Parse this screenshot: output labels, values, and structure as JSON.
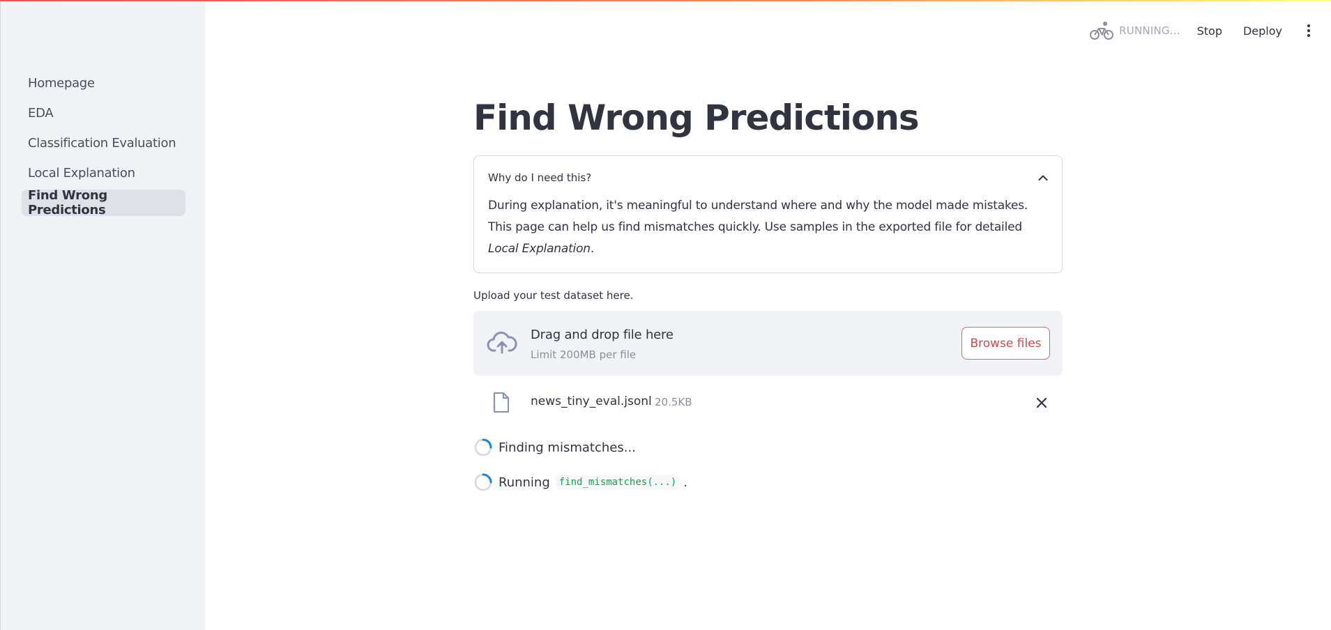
{
  "sidebar": {
    "items": [
      {
        "label": "Homepage",
        "active": false
      },
      {
        "label": "EDA",
        "active": false
      },
      {
        "label": "Classification Evaluation",
        "active": false
      },
      {
        "label": "Local Explanation",
        "active": false
      },
      {
        "label": "Find Wrong Predictions",
        "active": true
      }
    ]
  },
  "header": {
    "status_text": "RUNNING...",
    "stop_label": "Stop",
    "deploy_label": "Deploy",
    "running_icon": "bicycle-icon",
    "menu_icon": "kebab-menu-icon"
  },
  "main": {
    "title": "Find Wrong Predictions",
    "expander": {
      "title": "Why do I need this?",
      "body_text": "During explanation, it's meaningful to understand where and why the model made mistakes. This page can help us find mismatches quickly. Use samples in the exported file for detailed ",
      "body_emphasis": "Local Explanation",
      "body_end": "."
    },
    "upload": {
      "label": "Upload your test dataset here.",
      "drop_title": "Drag and drop file here",
      "drop_limit": "Limit 200MB per file",
      "browse_label": "Browse files"
    },
    "file": {
      "name": "news_tiny_eval.jsonl",
      "size": "20.5KB"
    },
    "status": {
      "finding": "Finding mismatches...",
      "running_prefix": "Running",
      "running_code": "find_mismatches(...)",
      "running_suffix": "."
    }
  },
  "colors": {
    "accent": "#ff4b4b",
    "sidebar_bg": "#f0f2f6",
    "code_green": "#1f9d55",
    "spinner_blue": "#1c83e1"
  }
}
